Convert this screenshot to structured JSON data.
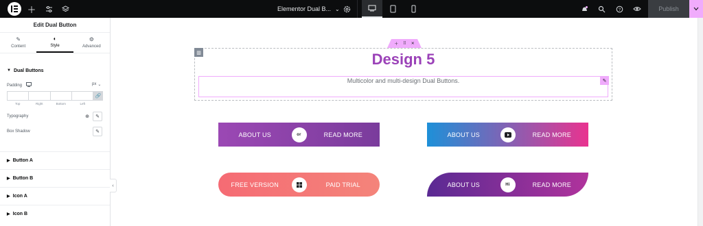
{
  "topbar": {
    "page_title": "Elementor Dual B...",
    "publish_label": "Publish"
  },
  "panel": {
    "title": "Edit Dual Button",
    "tabs": [
      {
        "label": "Content",
        "icon": "pencil-icon"
      },
      {
        "label": "Style",
        "icon": "half-circle-icon"
      },
      {
        "label": "Advanced",
        "icon": "gear-icon"
      }
    ],
    "active_tab": "Style",
    "section_title": "Dual Buttons",
    "padding_label": "Padding",
    "unit": "px",
    "padding_sides": [
      "Top",
      "Right",
      "Bottom",
      "Left"
    ],
    "typography_label": "Typography",
    "box_shadow_label": "Box Shadow",
    "accordions": [
      "Button A",
      "Button B",
      "Icon A",
      "Icon B"
    ]
  },
  "canvas": {
    "heading": "Design 5",
    "subtext": "Multicolor and multi-design Dual Buttons.",
    "buttons": [
      {
        "a": "ABOUT US",
        "b": "READ MORE",
        "middle": "or",
        "colors": [
          "#9b48b4",
          "#7a3c9c"
        ]
      },
      {
        "a": "ABOUT US",
        "b": "READ MORE",
        "middle_icon": "youtube-icon",
        "colors": [
          "#1e90d8",
          "#e9338f"
        ]
      },
      {
        "a": "FREE VERSION",
        "b": "PAID TRIAL",
        "middle_icon": "windows-icon",
        "colors": [
          "#f56b74",
          "#f4847a"
        ]
      },
      {
        "a": "ABOUT US",
        "b": "READ MORE",
        "middle": "Hi",
        "colors": [
          "#5a2a93",
          "#b0339c"
        ]
      }
    ]
  },
  "colors": {
    "accent": "#9b42b8",
    "handle_pink": "#f0abfc",
    "topbar_bg": "#0c0d0e"
  }
}
